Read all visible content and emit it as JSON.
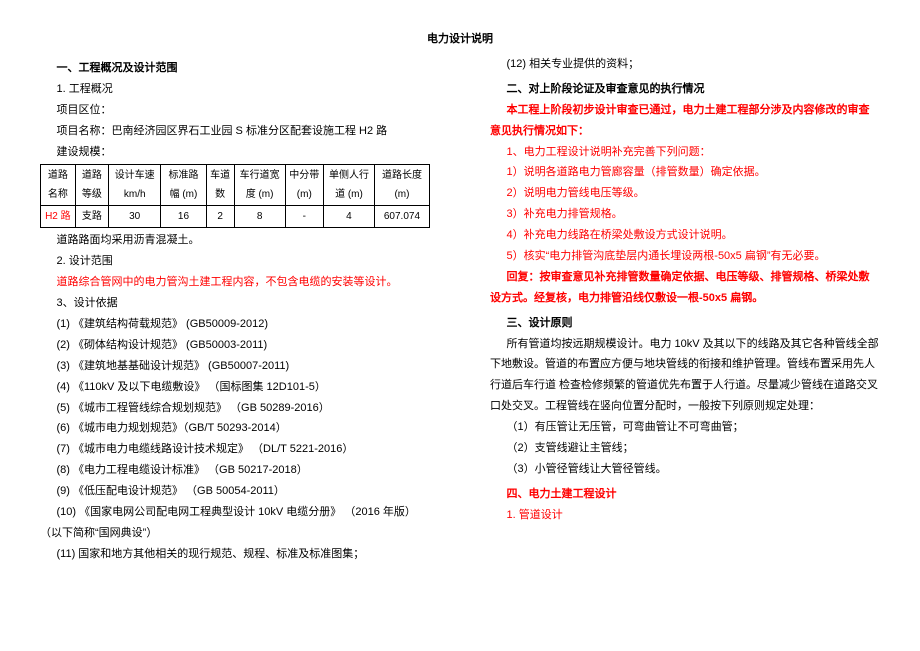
{
  "doc": {
    "title": "电力设计说明",
    "left": {
      "h1": "一、工程概况及设计范围",
      "p1": "1. 工程概况",
      "p2": "项目区位：",
      "p3": "项目名称：巴南经济园区界石工业园 S 标准分区配套设施工程 H2 路",
      "p4": "建设规模：",
      "table": {
        "headers": [
          "道路名称",
          "道路等级",
          "设计车速 km/h",
          "标准路幅 (m)",
          "车道数",
          "车行道宽度 (m)",
          "中分带(m)",
          "单侧人行道 (m)",
          "道路长度 (m)"
        ],
        "row": [
          "H2 路",
          "支路",
          "30",
          "16",
          "2",
          "8",
          "-",
          "4",
          "607.074"
        ]
      },
      "p5": "道路路面均采用沥青混凝土。",
      "p6": "2. 设计范围",
      "p7": "道路综合管网中的电力管沟土建工程内容，不包含电缆的安装等设计。",
      "p8": "3、设计依据",
      "r1": "(1) 《建筑结构荷载规范》 (GB50009-2012)",
      "r2": "(2) 《砌体结构设计规范》 (GB50003-2011)",
      "r3": "(3) 《建筑地基基础设计规范》 (GB50007-2011)",
      "r4": "(4) 《110kV 及以下电缆敷设》 （国标图集 12D101-5）",
      "r5": "(5) 《城市工程管线综合规划规范》 （GB 50289-2016）",
      "r6": "(6) 《城市电力规划规范》（GB/T 50293-2014）",
      "r7": "(7) 《城市电力电缆线路设计技术规定》 （DL/T 5221-2016）",
      "r8": "(8) 《电力工程电缆设计标准》 （GB 50217-2018）",
      "r9": "(9) 《低压配电设计规范》 （GB 50054-2011）",
      "r10": "(10) 《国家电网公司配电网工程典型设计  10kV 电缆分册》 （2016 年版）（以下简称“国网典设”）",
      "r11": "(11) 国家和地方其他相关的现行规范、规程、标准及标准图集；"
    },
    "right": {
      "r12": "(12) 相关专业提供的资料；",
      "h2": "二、对上阶段论证及审查意见的执行情况",
      "p1": "本工程上阶段初步设计审查已通过，电力土建工程部分涉及内容修改的审查意见执行情况如下：",
      "i1": "1、电力工程设计说明补充完善下列问题：",
      "i2": "1）说明各道路电力管廊容量（排管数量）确定依据。",
      "i3": "2）说明电力管线电压等级。",
      "i4": "3）补充电力排管规格。",
      "i5": "4）补充电力线路在桥梁处敷设方式设计说明。",
      "i6": "5）核实“电力排管沟底垫层内通长埋设两根-50x5 扁钢”有无必要。",
      "i7": "回复：按审查意见补充排管数量确定依据、电压等级、排管规格、桥梁处敷设方式。经复核，电力排管沿线仅敷设一根-50x5 扁钢。",
      "h3": "三、设计原则",
      "p2": "所有管道均按远期规模设计。电力 10kV 及其以下的线路及其它各种管线全部下地敷设。管道的布置应方便与地块管线的衔接和维护管理。管线布置采用先人行道后车行道 检查检修频繁的管道优先布置于人行道。尽量减少管线在道路交叉口处交叉。工程管线在竖向位置分配时，一般按下列原则规定处理：",
      "b1": "（1）有压管让无压管，可弯曲管让不可弯曲管；",
      "b2": "（2）支管线避让主管线；",
      "b3": "（3）小管径管线让大管径管线。",
      "h4": "四、电力土建工程设计",
      "p3": "1. 管道设计"
    }
  }
}
